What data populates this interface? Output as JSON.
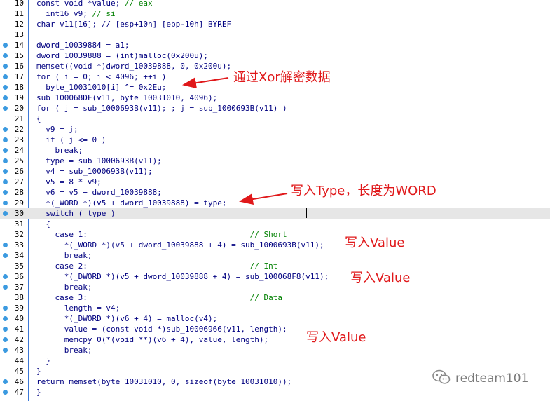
{
  "code_lines": [
    {
      "n": "10",
      "dot": false,
      "hl": false,
      "html": "const void *value; // eax"
    },
    {
      "n": "11",
      "dot": false,
      "hl": false,
      "html": "__int16 v9; // si"
    },
    {
      "n": "12",
      "dot": false,
      "hl": false,
      "html": "char v11[16]; // [esp+10h] [ebp-10h] BYREF"
    },
    {
      "n": "13",
      "dot": false,
      "hl": false,
      "html": ""
    },
    {
      "n": "14",
      "dot": true,
      "hl": false,
      "html": "dword_10039884 = a1;"
    },
    {
      "n": "15",
      "dot": true,
      "hl": false,
      "html": "dword_10039888 = (int)malloc(0x200u);"
    },
    {
      "n": "16",
      "dot": true,
      "hl": false,
      "html": "memset((void *)dword_10039888, 0, 0x200u);"
    },
    {
      "n": "17",
      "dot": true,
      "hl": false,
      "html": "for ( i = 0; i < 4096; ++i )"
    },
    {
      "n": "18",
      "dot": true,
      "hl": false,
      "html": "  byte_10031010[i] ^= 0x2Eu;"
    },
    {
      "n": "19",
      "dot": true,
      "hl": false,
      "html": "sub_100068DF(v11, byte_10031010, 4096);"
    },
    {
      "n": "20",
      "dot": true,
      "hl": false,
      "html": "for ( j = sub_1000693B(v11); ; j = sub_1000693B(v11) )"
    },
    {
      "n": "21",
      "dot": false,
      "hl": false,
      "html": "{"
    },
    {
      "n": "22",
      "dot": true,
      "hl": false,
      "html": "  v9 = j;"
    },
    {
      "n": "23",
      "dot": true,
      "hl": false,
      "html": "  if ( j <= 0 )"
    },
    {
      "n": "24",
      "dot": true,
      "hl": false,
      "html": "    break;"
    },
    {
      "n": "25",
      "dot": true,
      "hl": false,
      "html": "  type = sub_1000693B(v11);"
    },
    {
      "n": "26",
      "dot": true,
      "hl": false,
      "html": "  v4 = sub_1000693B(v11);"
    },
    {
      "n": "27",
      "dot": true,
      "hl": false,
      "html": "  v5 = 8 * v9;"
    },
    {
      "n": "28",
      "dot": true,
      "hl": false,
      "html": "  v6 = v5 + dword_10039888;"
    },
    {
      "n": "29",
      "dot": true,
      "hl": false,
      "html": "  *(_WORD *)(v5 + dword_10039888) = type;"
    },
    {
      "n": "30",
      "dot": true,
      "hl": true,
      "html": "  switch ( type )"
    },
    {
      "n": "31",
      "dot": false,
      "hl": false,
      "html": "  {"
    },
    {
      "n": "32",
      "dot": false,
      "hl": false,
      "html": "    case 1:                                   // Short"
    },
    {
      "n": "33",
      "dot": true,
      "hl": false,
      "html": "      *(_WORD *)(v5 + dword_10039888 + 4) = sub_1000693B(v11);"
    },
    {
      "n": "34",
      "dot": true,
      "hl": false,
      "html": "      break;"
    },
    {
      "n": "35",
      "dot": false,
      "hl": false,
      "html": "    case 2:                                   // Int"
    },
    {
      "n": "36",
      "dot": true,
      "hl": false,
      "html": "      *(_DWORD *)(v5 + dword_10039888 + 4) = sub_100068F8(v11);"
    },
    {
      "n": "37",
      "dot": true,
      "hl": false,
      "html": "      break;"
    },
    {
      "n": "38",
      "dot": false,
      "hl": false,
      "html": "    case 3:                                   // Data"
    },
    {
      "n": "39",
      "dot": true,
      "hl": false,
      "html": "      length = v4;"
    },
    {
      "n": "40",
      "dot": true,
      "hl": false,
      "html": "      *(_DWORD *)(v6 + 4) = malloc(v4);"
    },
    {
      "n": "41",
      "dot": true,
      "hl": false,
      "html": "      value = (const void *)sub_10006966(v11, length);"
    },
    {
      "n": "42",
      "dot": true,
      "hl": false,
      "html": "      memcpy_0(*(void **)(v6 + 4), value, length);"
    },
    {
      "n": "43",
      "dot": true,
      "hl": false,
      "html": "      break;"
    },
    {
      "n": "44",
      "dot": false,
      "hl": false,
      "html": "  }"
    },
    {
      "n": "45",
      "dot": false,
      "hl": false,
      "html": "}"
    },
    {
      "n": "46",
      "dot": true,
      "hl": false,
      "html": "return memset(byte_10031010, 0, sizeof(byte_10031010));"
    },
    {
      "n": "47",
      "dot": true,
      "hl": false,
      "html": "}"
    }
  ],
  "annotations": {
    "xor": "通过Xor解密数据",
    "type": "写入Type，长度为WORD",
    "value1": "写入Value",
    "value2": "写入Value",
    "value3": "写入Value"
  },
  "watermark": {
    "text": "redteam101",
    "icon": "wechat-icon"
  },
  "colors": {
    "annotation": "#e0181a",
    "breakpoint_dot": "#3b9ae0",
    "keyword": "#000080",
    "variable": "#3c3cff",
    "comment": "#008000",
    "highlight_line": "#e6e6e6"
  }
}
